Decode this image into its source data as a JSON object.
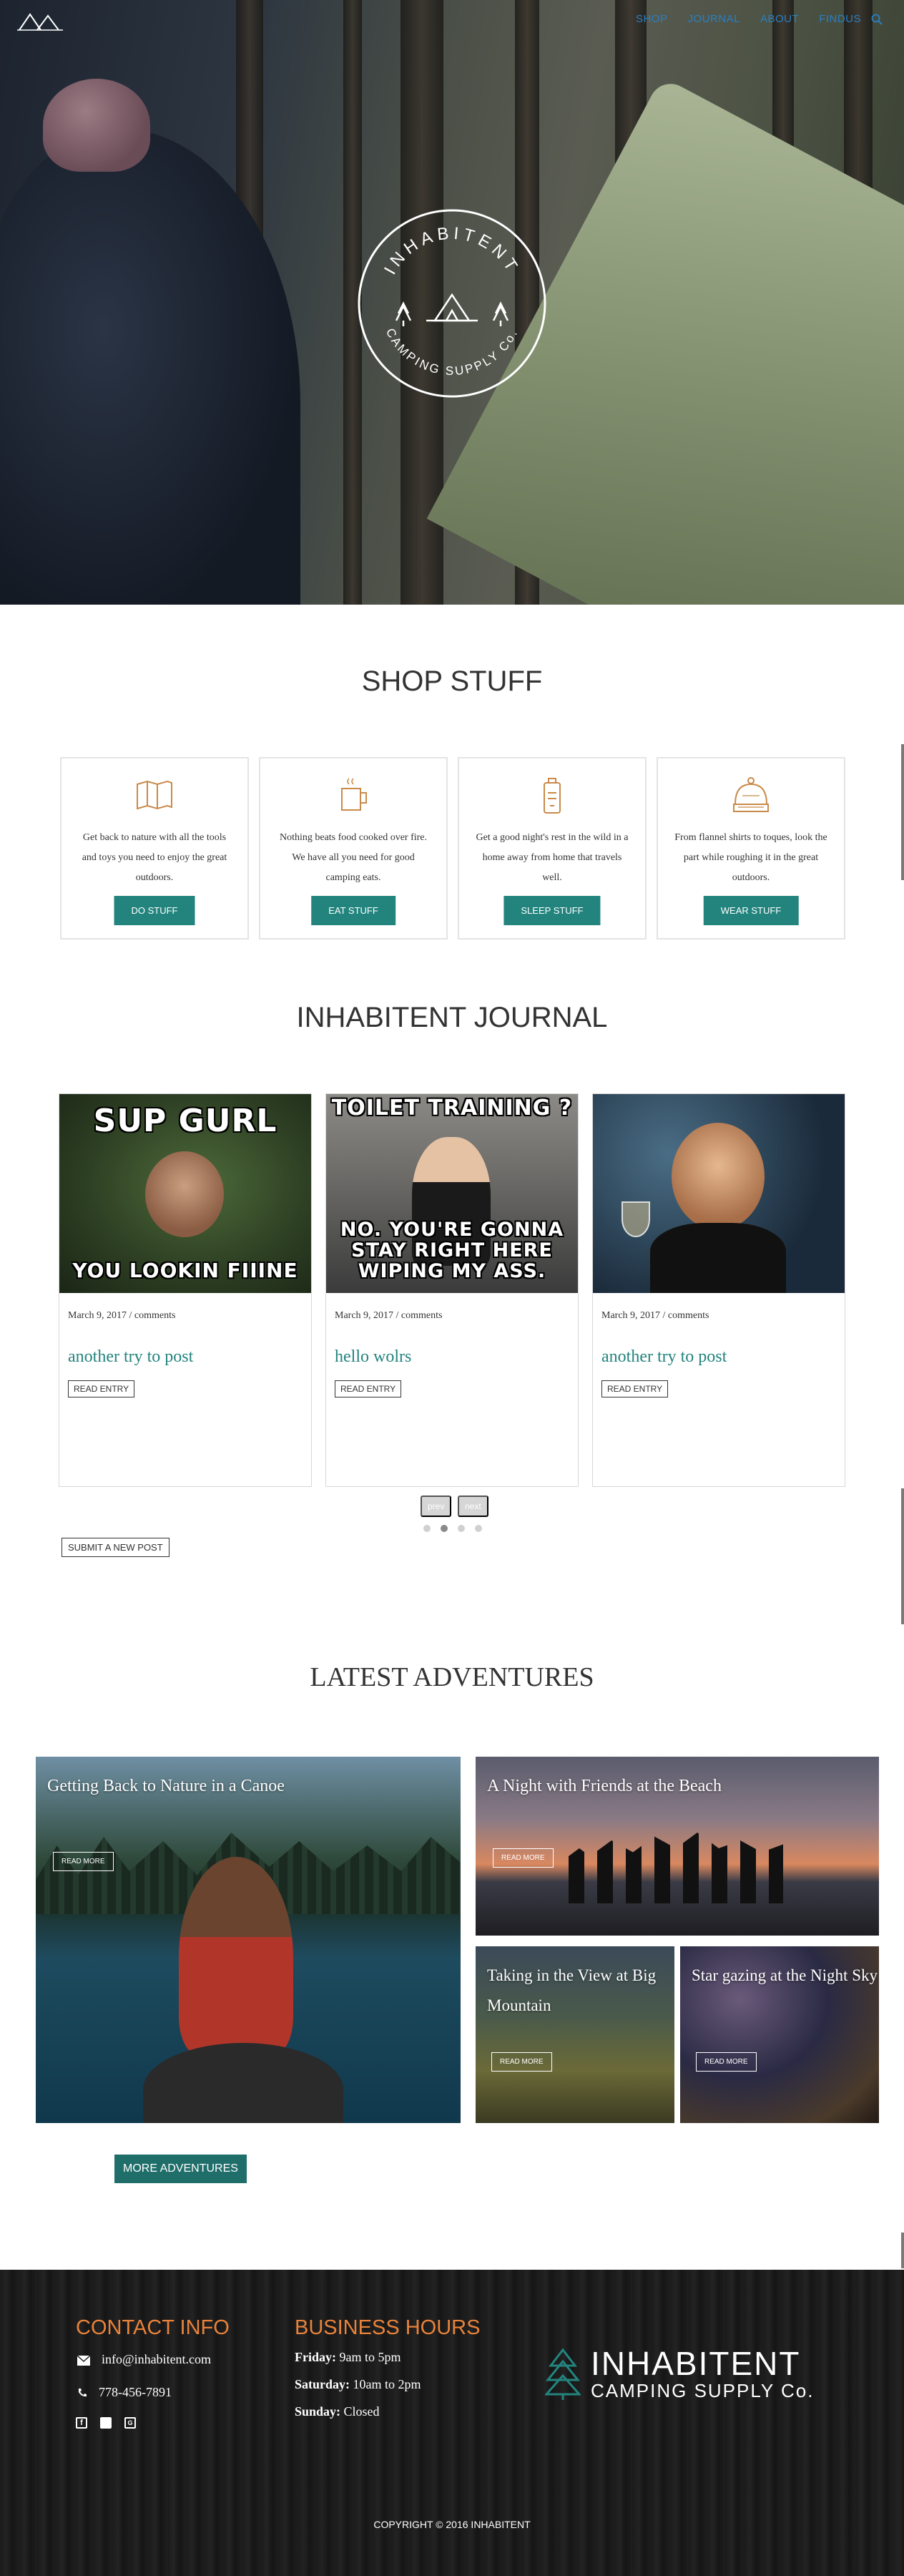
{
  "nav": {
    "items": [
      "SHOP",
      "JOURNAL",
      "ABOUT",
      "FINDUS"
    ],
    "search_icon": "search-icon"
  },
  "hero": {
    "badge_top": "INHABITENT",
    "badge_bottom": "CAMPING SUPPLY Co."
  },
  "shop": {
    "title": "SHOP STUFF",
    "cards": [
      {
        "icon": "map-icon",
        "text": "Get back to nature with all the tools and toys you need to enjoy the great outdoors.",
        "button": "DO STUFF"
      },
      {
        "icon": "mug-icon",
        "text": "Nothing beats food cooked over fire. We have all you need for good camping eats.",
        "button": "EAT STUFF"
      },
      {
        "icon": "lantern-icon",
        "text": "Get a good night's rest in the wild in a home away from home that travels well.",
        "button": "SLEEP STUFF"
      },
      {
        "icon": "beanie-icon",
        "text": "From flannel shirts to toques, look the part while roughing it in the great outdoors.",
        "button": "WEAR STUFF"
      }
    ]
  },
  "journal": {
    "title": "INHABITENT JOURNAL",
    "posts": [
      {
        "meme_top": "SUP GURL",
        "meme_bottom": "YOU LOOKIN FIIINE",
        "meta": "March 9, 2017 / comments",
        "title": "another try to post",
        "button": "READ ENTRY"
      },
      {
        "meme_top": "TOILET TRAINING ?",
        "meme_bottom": "NO.  YOU'RE GONNA STAY RIGHT HERE WIPING MY ASS.",
        "meta": "March 9, 2017 / comments",
        "title": "hello wolrs",
        "button": "READ ENTRY"
      },
      {
        "meme_top": "",
        "meme_bottom": "",
        "meta": "March 9, 2017 / comments",
        "title": "another try to post",
        "button": "READ ENTRY"
      }
    ],
    "prev": "prev",
    "next": "next",
    "submit": "SUBMIT A NEW POST"
  },
  "adventures": {
    "title": "LATEST ADVENTURES",
    "items": [
      {
        "title": "Getting Back to Nature in a Canoe",
        "button": "READ MORE"
      },
      {
        "title": "A Night with Friends at the Beach",
        "button": "READ MORE"
      },
      {
        "title": "Taking in the View at Big Mountain",
        "button": "READ MORE"
      },
      {
        "title": "Star gazing at the Night Sky",
        "button": "READ MORE"
      }
    ],
    "more_button": "MORE ADVENTURES"
  },
  "footer": {
    "contact_title": "CONTACT INFO",
    "email": "info@inhabitent.com",
    "phone": "778-456-7891",
    "hours_title": "BUSINESS HOURS",
    "hours": [
      {
        "day": "Friday:",
        "time": "9am to 5pm"
      },
      {
        "day": "Saturday:",
        "time": "10am to 2pm"
      },
      {
        "day": "Sunday:",
        "time": "Closed"
      }
    ],
    "brand_name": "INHABITENT",
    "brand_sub": "CAMPING SUPPLY Co.",
    "copyright": "COPYRIGHT © 2016 INHABITENT"
  },
  "colors": {
    "accent": "#23847e",
    "nav_link": "#2a7fc1",
    "footer_heading": "#e8823a",
    "journal_title": "#23847e"
  }
}
